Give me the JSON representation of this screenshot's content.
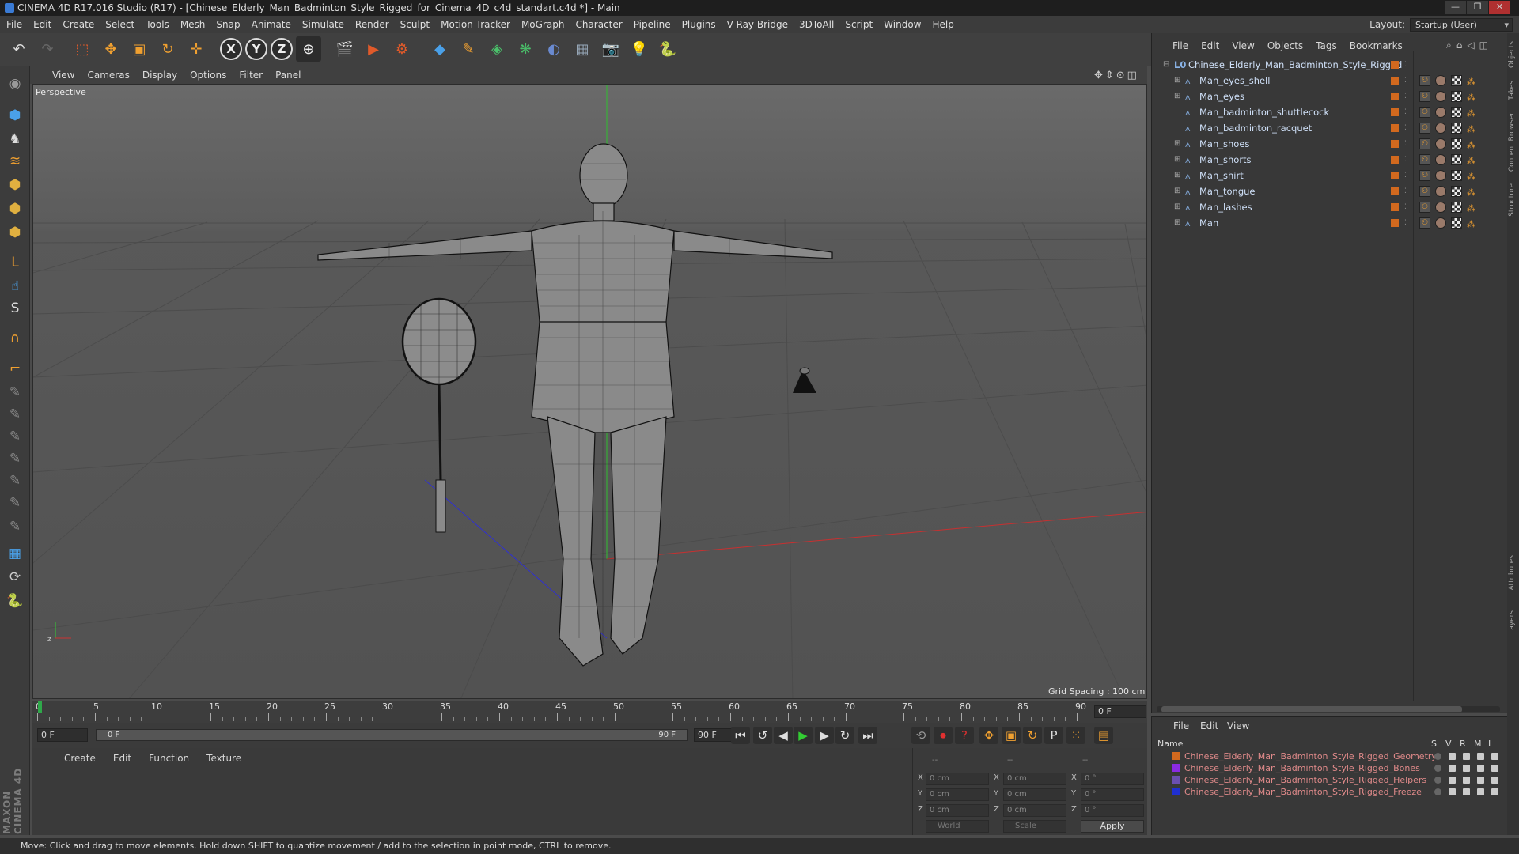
{
  "window": {
    "title": "CINEMA 4D R17.016 Studio (R17) - [Chinese_Elderly_Man_Badminton_Style_Rigged_for_Cinema_4D_c4d_standart.c4d *] - Main"
  },
  "menubar": {
    "items": [
      "File",
      "Edit",
      "Create",
      "Select",
      "Tools",
      "Mesh",
      "Snap",
      "Animate",
      "Simulate",
      "Render",
      "Sculpt",
      "Motion Tracker",
      "MoGraph",
      "Character",
      "Pipeline",
      "Plugins",
      "V-Ray Bridge",
      "3DToAll",
      "Script",
      "Window",
      "Help"
    ],
    "layout_label": "Layout:",
    "layout_value": "Startup (User)"
  },
  "viewport": {
    "menu": [
      "View",
      "Cameras",
      "Display",
      "Options",
      "Filter",
      "Panel"
    ],
    "label": "Perspective",
    "grid_spacing": "Grid Spacing : 100 cm"
  },
  "timeline": {
    "ticks": [
      "0",
      "5",
      "10",
      "15",
      "20",
      "25",
      "30",
      "35",
      "40",
      "45",
      "50",
      "55",
      "60",
      "65",
      "70",
      "75",
      "80",
      "85",
      "90"
    ],
    "current_frame": "0 F",
    "start_field": "0 F",
    "range_start": "0 F",
    "range_end": "90 F",
    "end_field": "90 F"
  },
  "material_manager": {
    "menu": [
      "Create",
      "Edit",
      "Function",
      "Texture"
    ]
  },
  "coordinates": {
    "header": [
      "--",
      "--",
      "--"
    ],
    "rows": [
      {
        "axis": "X",
        "pos": "0 cm",
        "size": "0 cm",
        "rot_axis": "X",
        "rot": "0 °"
      },
      {
        "axis": "Y",
        "pos": "0 cm",
        "size": "0 cm",
        "rot_axis": "Y",
        "rot": "0 °"
      },
      {
        "axis": "Z",
        "pos": "0 cm",
        "size": "0 cm",
        "rot_axis": "Z",
        "rot": "0 °"
      }
    ],
    "mode": "World",
    "type": "Scale",
    "apply": "Apply"
  },
  "object_manager": {
    "menu": [
      "File",
      "Edit",
      "View",
      "Objects",
      "Tags",
      "Bookmarks"
    ],
    "root": "Chinese_Elderly_Man_Badminton_Style_Rigged",
    "objects": [
      "Man_eyes_shell",
      "Man_eyes",
      "Man_badminton_shuttlecock",
      "Man_badminton_racquet",
      "Man_shoes",
      "Man_shorts",
      "Man_shirt",
      "Man_tongue",
      "Man_lashes",
      "Man"
    ]
  },
  "layer_manager": {
    "menu": [
      "File",
      "Edit",
      "View"
    ],
    "col_name": "Name",
    "cols": [
      "S",
      "V",
      "R",
      "M",
      "L"
    ],
    "layers": [
      {
        "name": "Chinese_Elderly_Man_Badminton_Style_Rigged_Geometry",
        "color": "#d2691e"
      },
      {
        "name": "Chinese_Elderly_Man_Badminton_Style_Rigged_Bones",
        "color": "#8a2be2"
      },
      {
        "name": "Chinese_Elderly_Man_Badminton_Style_Rigged_Helpers",
        "color": "#6a4fb0"
      },
      {
        "name": "Chinese_Elderly_Man_Badminton_Style_Rigged_Freeze",
        "color": "#1f2fd0"
      }
    ]
  },
  "side_tabs": [
    "Objects",
    "Takes",
    "Content Browser",
    "Structure",
    "Attributes",
    "Layers"
  ],
  "status": "Move: Click and drag to move elements. Hold down SHIFT to quantize movement / add to the selection in point mode, CTRL to remove.",
  "brand": "MAXON CINEMA 4D",
  "icons": {
    "toolbar": [
      "undo-icon",
      "redo-icon",
      "live-select-icon",
      "move-icon",
      "scale-icon",
      "rotate-icon",
      "transform-icon",
      "x-axis-icon",
      "y-axis-icon",
      "z-axis-icon",
      "world-coord-icon",
      "render-view-icon",
      "render-picture-icon",
      "render-settings-icon",
      "cube-icon",
      "pen-icon",
      "subdivision-icon",
      "cloner-icon",
      "deformer-icon",
      "floor-icon",
      "camera-icon",
      "light-icon",
      "python-icon"
    ]
  }
}
